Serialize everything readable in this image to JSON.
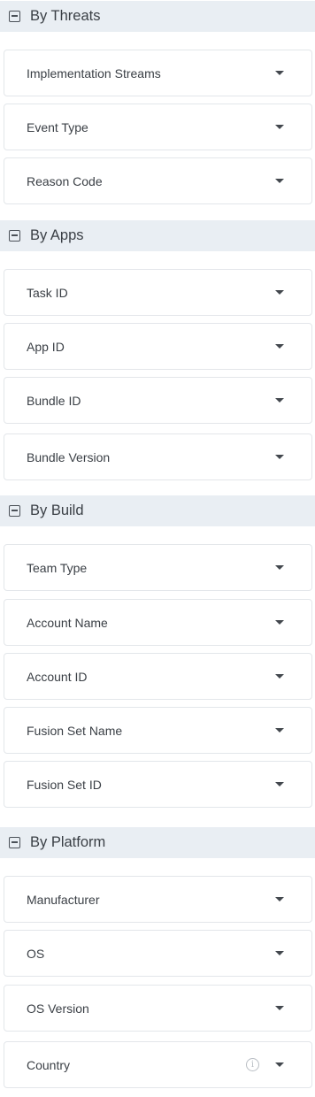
{
  "sections": [
    {
      "title": "By Threats",
      "fields": [
        "Implementation Streams",
        "Event Type",
        "Reason Code"
      ]
    },
    {
      "title": "By Apps",
      "fields": [
        "Task ID",
        "App ID",
        "Bundle ID",
        "Bundle Version"
      ]
    },
    {
      "title": "By Build",
      "fields": [
        "Team Type",
        "Account Name",
        "Account ID",
        "Fusion Set Name",
        "Fusion Set ID"
      ]
    },
    {
      "title": "By Platform",
      "fields": [
        "Manufacturer",
        "OS",
        "OS Version",
        "Country"
      ]
    }
  ],
  "icons": {
    "collapse": "minus-square-icon",
    "caret": "caret-down-icon",
    "info": "info-icon"
  },
  "info_glyph": "i"
}
